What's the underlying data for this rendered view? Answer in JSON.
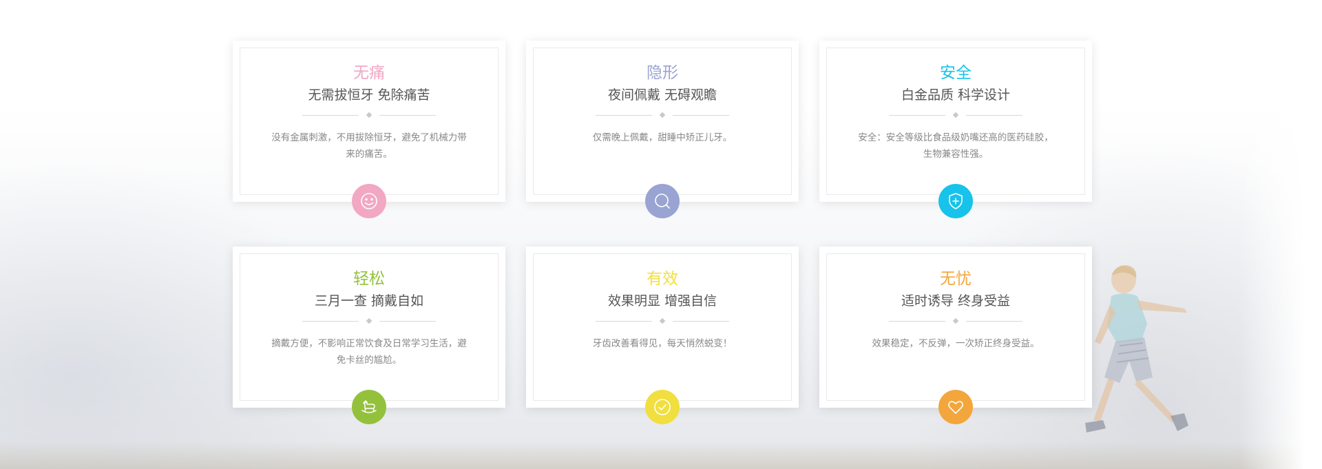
{
  "colors": {
    "pink": "#f2a7c3",
    "lavender": "#9aa4d3",
    "cyan": "#17c3ea",
    "green": "#94c13c",
    "yellow": "#f1df3f",
    "orange": "#f3a63c",
    "subtitle": "#555555",
    "description": "#888888"
  },
  "cards": [
    {
      "title": "无痛",
      "subtitle": "无需拔恒牙 免除痛苦",
      "description": "没有金属刺激，不用拔除恒牙，避免了机械力带来的痛苦。",
      "icon": "smiley-face-icon"
    },
    {
      "title": "隐形",
      "subtitle": "夜间佩戴 无碍观瞻",
      "description": "仅需晚上佩戴，甜睡中矫正儿牙。",
      "icon": "magnifier-icon"
    },
    {
      "title": "安全",
      "subtitle": "白金品质 科学设计",
      "description": "安全：安全等级比食品级奶嘴还高的医药硅胶，生物兼容性强。",
      "icon": "shield-plus-icon"
    },
    {
      "title": "轻松",
      "subtitle": "三月一查 摘戴自如",
      "description": "摘戴方便，不影响正常饮食及日常学习生活，避免卡丝的尴尬。",
      "icon": "rocking-horse-icon"
    },
    {
      "title": "有效",
      "subtitle": "效果明显 增强自信",
      "description": "牙齿改善看得见，每天悄然蜕变！",
      "icon": "check-circle-icon"
    },
    {
      "title": "无忧",
      "subtitle": "适时诱导 终身受益",
      "description": "效果稳定，不反弹，一次矫正终身受益。",
      "icon": "heart-icon"
    }
  ]
}
